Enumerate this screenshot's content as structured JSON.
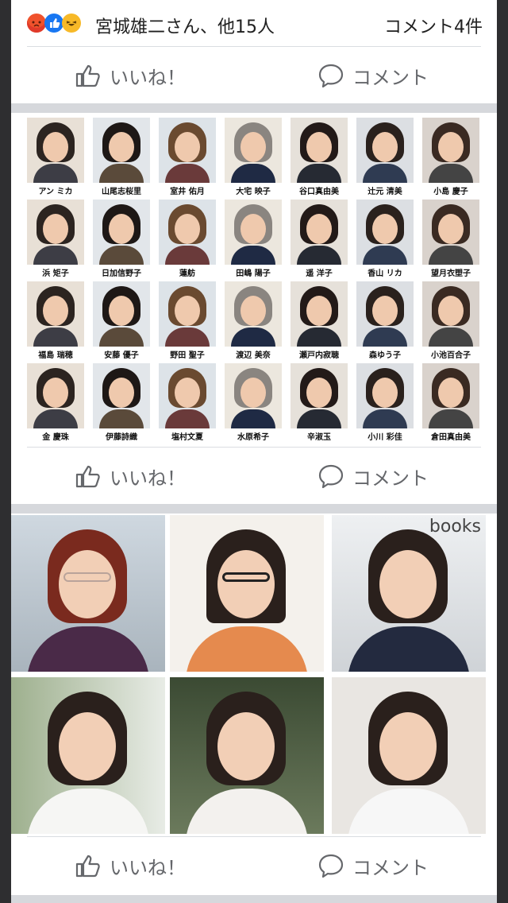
{
  "post": {
    "reactions": {
      "icons": [
        "angry-icon",
        "like-icon",
        "haha-icon"
      ],
      "names": "宮城雄二さん、他15人"
    },
    "comment_count": "コメント4件"
  },
  "actions": {
    "like_label": "いいね！",
    "comment_label": "コメント"
  },
  "grid": {
    "names": [
      "アン ミカ",
      "山尾志桜里",
      "室井 佑月",
      "大宅 映子",
      "谷口真由美",
      "辻元 清美",
      "小島 慶子",
      "浜 矩子",
      "日加信野子",
      "蓮舫",
      "田嶋 陽子",
      "遥 洋子",
      "香山 リカ",
      "望月衣塑子",
      "福島 瑞穂",
      "安藤 優子",
      "野田 聖子",
      "渡辺 美奈",
      "瀬戸内寂聴",
      "森ゆう子",
      "小池百合子",
      "金 慶珠",
      "伊藤詩織",
      "塩村文夏",
      "水原希子",
      "辛淑玉",
      "小川 彩佳",
      "倉田真由美"
    ]
  },
  "photos": {
    "books_sign": "books"
  },
  "colors": {
    "accent": "#1877f2",
    "action_text": "#65676b",
    "background": "#2e2e30",
    "separator": "#d6d8dc"
  }
}
